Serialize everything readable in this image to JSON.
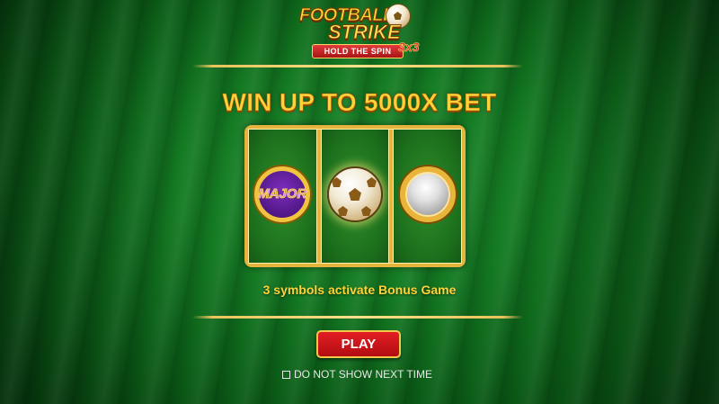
{
  "logo": {
    "line1": "FOOTBALL",
    "line2": "STRIKE",
    "ribbon": "HOLD THE SPIN",
    "badge": "3x3",
    "icon": "football-icon"
  },
  "headline": "WIN UP TO 5000X BET",
  "reels": [
    {
      "symbol": "major-coin",
      "label": "MAJOR"
    },
    {
      "symbol": "football-icon",
      "label": ""
    },
    {
      "symbol": "silver-coin",
      "label": ""
    }
  ],
  "caption": "3 symbols activate Bonus Game",
  "play_button": "PLAY",
  "checkbox": {
    "label": "DO NOT SHOW NEXT TIME",
    "checked": false
  },
  "colors": {
    "gold": "#ffd23a",
    "frame": "#e6b43c",
    "play": "#e21f24",
    "felt": "#137a22"
  }
}
